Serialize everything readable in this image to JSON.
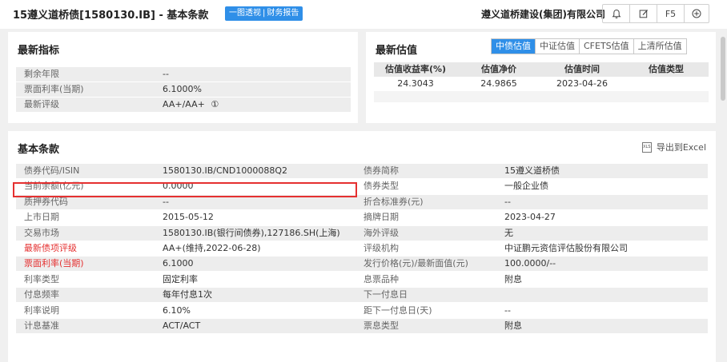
{
  "header": {
    "title": "15遵义道桥债[1580130.IB] - 基本条款",
    "btn_part1": "一图透视",
    "btn_sep": "|",
    "btn_part2": "财务报告",
    "company": "遵义道桥建设(集团)有限公司",
    "icons": {
      "bell": "bell-icon",
      "edit": "edit-icon",
      "f5": "F5",
      "add": "plus-circle-icon"
    }
  },
  "latest_indicators": {
    "title": "最新指标",
    "rows": [
      {
        "label": "剩余年限",
        "value": "--"
      },
      {
        "label": "票面利率(当期)",
        "value": "6.1000%"
      },
      {
        "label": "最新评级",
        "value": "AA+/AA+",
        "info": "①"
      }
    ]
  },
  "latest_valuation": {
    "title": "最新估值",
    "tabs": [
      "中债估值",
      "中证估值",
      "CFETS估值",
      "上清所估值"
    ],
    "active_tab": 0,
    "columns": [
      "估值收益率(%)",
      "估值净价",
      "估值时间",
      "估值类型"
    ],
    "row": [
      "24.3043",
      "24.9865",
      "2023-04-26",
      ""
    ]
  },
  "basic_terms": {
    "title": "基本条款",
    "export_label": "导出到Excel",
    "left": [
      {
        "label": "债券代码/ISIN",
        "value": "1580130.IB/CND1000088Q2"
      },
      {
        "label": "当前余额(亿元)",
        "value": "0.0000"
      },
      {
        "label": "质押券代码",
        "value": "--"
      },
      {
        "label": "上市日期",
        "value": "2015-05-12"
      },
      {
        "label": "交易市场",
        "value": "1580130.IB(银行间债券),127186.SH(上海)"
      },
      {
        "label": "最新债项评级",
        "value": "AA+(维持,2022-06-28)"
      },
      {
        "label": "票面利率(当期)",
        "value": "6.1000"
      },
      {
        "label": "利率类型",
        "value": "固定利率"
      },
      {
        "label": "付息频率",
        "value": "每年付息1次"
      },
      {
        "label": "利率说明",
        "value": "6.10%"
      },
      {
        "label": "计息基准",
        "value": "ACT/ACT"
      }
    ],
    "right": [
      {
        "label": "债券简称",
        "value": "15遵义道桥债"
      },
      {
        "label": "债券类型",
        "value": "一般企业债"
      },
      {
        "label": "折合标准券(元)",
        "value": "--"
      },
      {
        "label": "摘牌日期",
        "value": "2023-04-27"
      },
      {
        "label": "海外评级",
        "value": "无"
      },
      {
        "label": "评级机构",
        "value": "中证鹏元资信评估股份有限公司"
      },
      {
        "label": "发行价格(元)/最新面值(元)",
        "value": "100.0000/--"
      },
      {
        "label": "息票品种",
        "value": "附息"
      },
      {
        "label": "下一付息日",
        "value": ""
      },
      {
        "label": "距下一付息日(天)",
        "value": "--"
      },
      {
        "label": "票息类型",
        "value": "附息"
      }
    ],
    "red_labels": [
      5,
      6
    ],
    "highlighted_row": 1
  }
}
